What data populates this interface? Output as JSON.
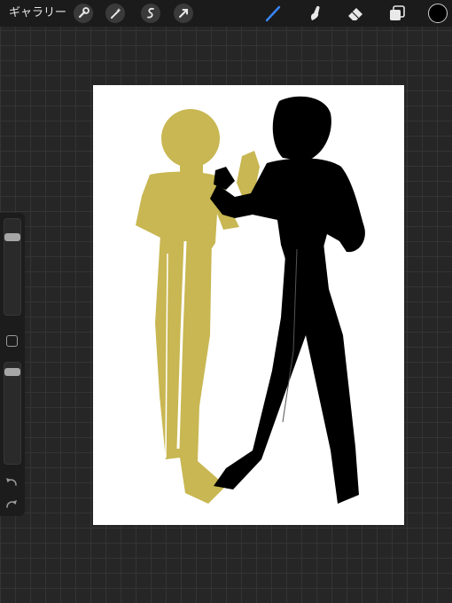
{
  "toolbar": {
    "gallery_label": "ギャラリー",
    "left_tools": [
      "wrench-icon",
      "magic-wand-icon",
      "selection-icon",
      "transform-arrow-icon"
    ],
    "right_tools": [
      "brush-icon",
      "smudge-icon",
      "eraser-icon",
      "layers-icon"
    ],
    "active_tool": "brush-icon",
    "active_color": "#000000",
    "accent": "#3a86ff"
  },
  "sidebar": {
    "brush_size_level": 0.93,
    "opacity_level": 0.93,
    "undo_icon": "undo-icon",
    "redo_icon": "redo-icon"
  },
  "canvas": {
    "background": "#ffffff",
    "figure_colors": [
      "#c8b752",
      "#000000"
    ]
  }
}
